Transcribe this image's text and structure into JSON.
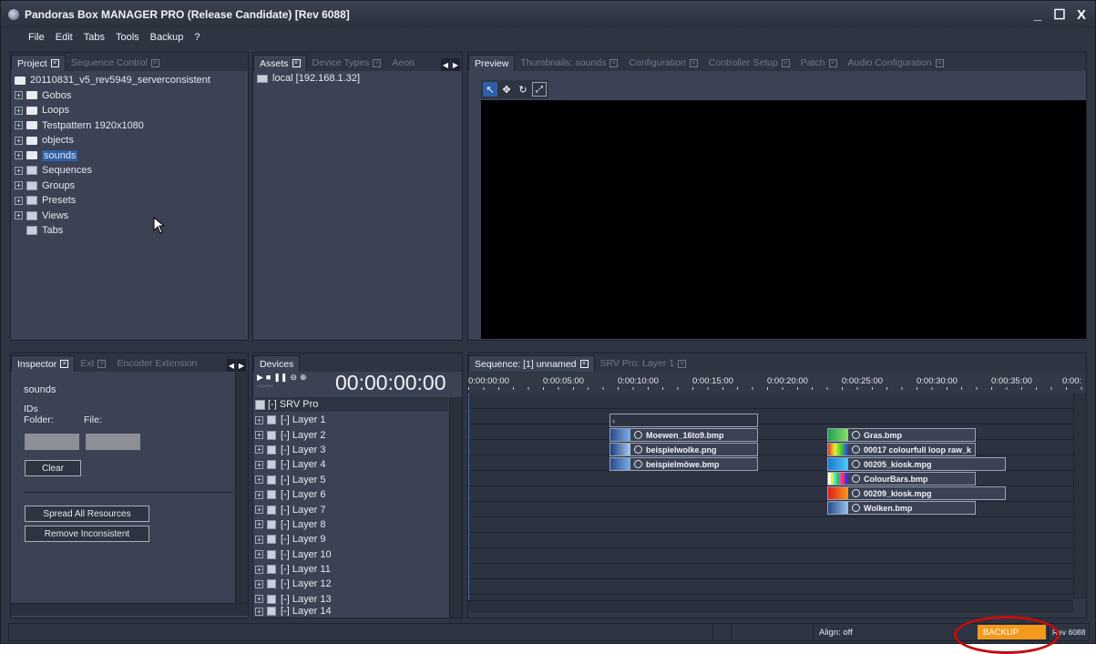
{
  "window": {
    "title": "Pandoras Box MANAGER PRO (Release Candidate) [Rev 6088]",
    "controls": [
      "_",
      "☐",
      "X"
    ]
  },
  "menu": [
    "File",
    "Edit",
    "Tabs",
    "Tools",
    "Backup",
    "?"
  ],
  "project_panel": {
    "tabs": [
      "Project",
      "Sequence Control"
    ],
    "root": "20110831_v5_rev5949_serverconsistent",
    "items": [
      {
        "label": "Gobos",
        "icon": "folder-icon"
      },
      {
        "label": "Loops",
        "icon": "folder-icon"
      },
      {
        "label": "Testpattern 1920x1080",
        "icon": "folder-icon"
      },
      {
        "label": "objects",
        "icon": "folder-icon"
      },
      {
        "label": "sounds",
        "icon": "folder-icon",
        "selected": true
      },
      {
        "label": "Sequences",
        "icon": "sequences-icon"
      },
      {
        "label": "Groups",
        "icon": "groups-icon"
      },
      {
        "label": "Presets",
        "icon": "presets-icon"
      },
      {
        "label": "Views",
        "icon": "views-icon"
      },
      {
        "label": "Tabs",
        "icon": "tabs-icon"
      }
    ]
  },
  "assets_panel": {
    "tabs": [
      "Assets",
      "Device Types",
      "Aeon"
    ],
    "items": [
      "local [192.168.1.32]"
    ]
  },
  "preview_panel": {
    "tabs": [
      "Preview",
      "Thumbnails: sounds",
      "Configuration",
      "Controller Setup",
      "Patch",
      "Audio Configuration"
    ]
  },
  "inspector_panel": {
    "tabs": [
      "Inspector",
      "Ext",
      "Encoder Extension"
    ],
    "name": "sounds",
    "ids_label": "IDs",
    "folder_label": "Folder:",
    "file_label": "File:",
    "clear_label": "Clear",
    "spread_label": "Spread All Resources",
    "remove_label": "Remove Inconsistent"
  },
  "devices_panel": {
    "tab": "Devices",
    "timecode": "00:00:00:00",
    "small_time": "--:--:--",
    "server": "[-] SRV Pro",
    "layers": [
      "[-] Layer 1",
      "[-] Layer 2",
      "[-] Layer 3",
      "[-] Layer 4",
      "[-] Layer 5",
      "[-] Layer 6",
      "[-] Layer 7",
      "[-] Layer 8",
      "[-] Layer 9",
      "[-] Layer 10",
      "[-] Layer 11",
      "[-] Layer 12",
      "[-] Layer 13",
      "[-] Layer 14"
    ]
  },
  "sequence_panel": {
    "tabs": [
      "Sequence: [1] unnamed",
      "SRV Pro: Layer 1"
    ],
    "ruler": [
      "0:00:00:00",
      "0:00:05:00",
      "0:00:10:00",
      "0:00:15:00",
      "0:00:20:00",
      "0:00:25:00",
      "0:00:30:00",
      "0:00:35:00",
      "0:00:"
    ],
    "clips_left": [
      "Moewen_16to9.bmp",
      "beispielwolke.png",
      "beispielmöwe.bmp"
    ],
    "clips_right": [
      "Gras.bmp",
      "00017 colourfull loop raw_k",
      "00205_kiosk.mpg",
      "ColourBars.bmp",
      "00209_kiosk.mpg",
      "Wolken.bmp"
    ]
  },
  "statusbar": {
    "align": "Align: off",
    "backup": "BACKUP",
    "rev": "Rev 6088"
  },
  "colors": {
    "background": "#2d3442",
    "panel": "#3a4254",
    "selection": "#2f5fa8",
    "backup": "#f39a1c",
    "highlight_ring": "#c40d0d"
  }
}
